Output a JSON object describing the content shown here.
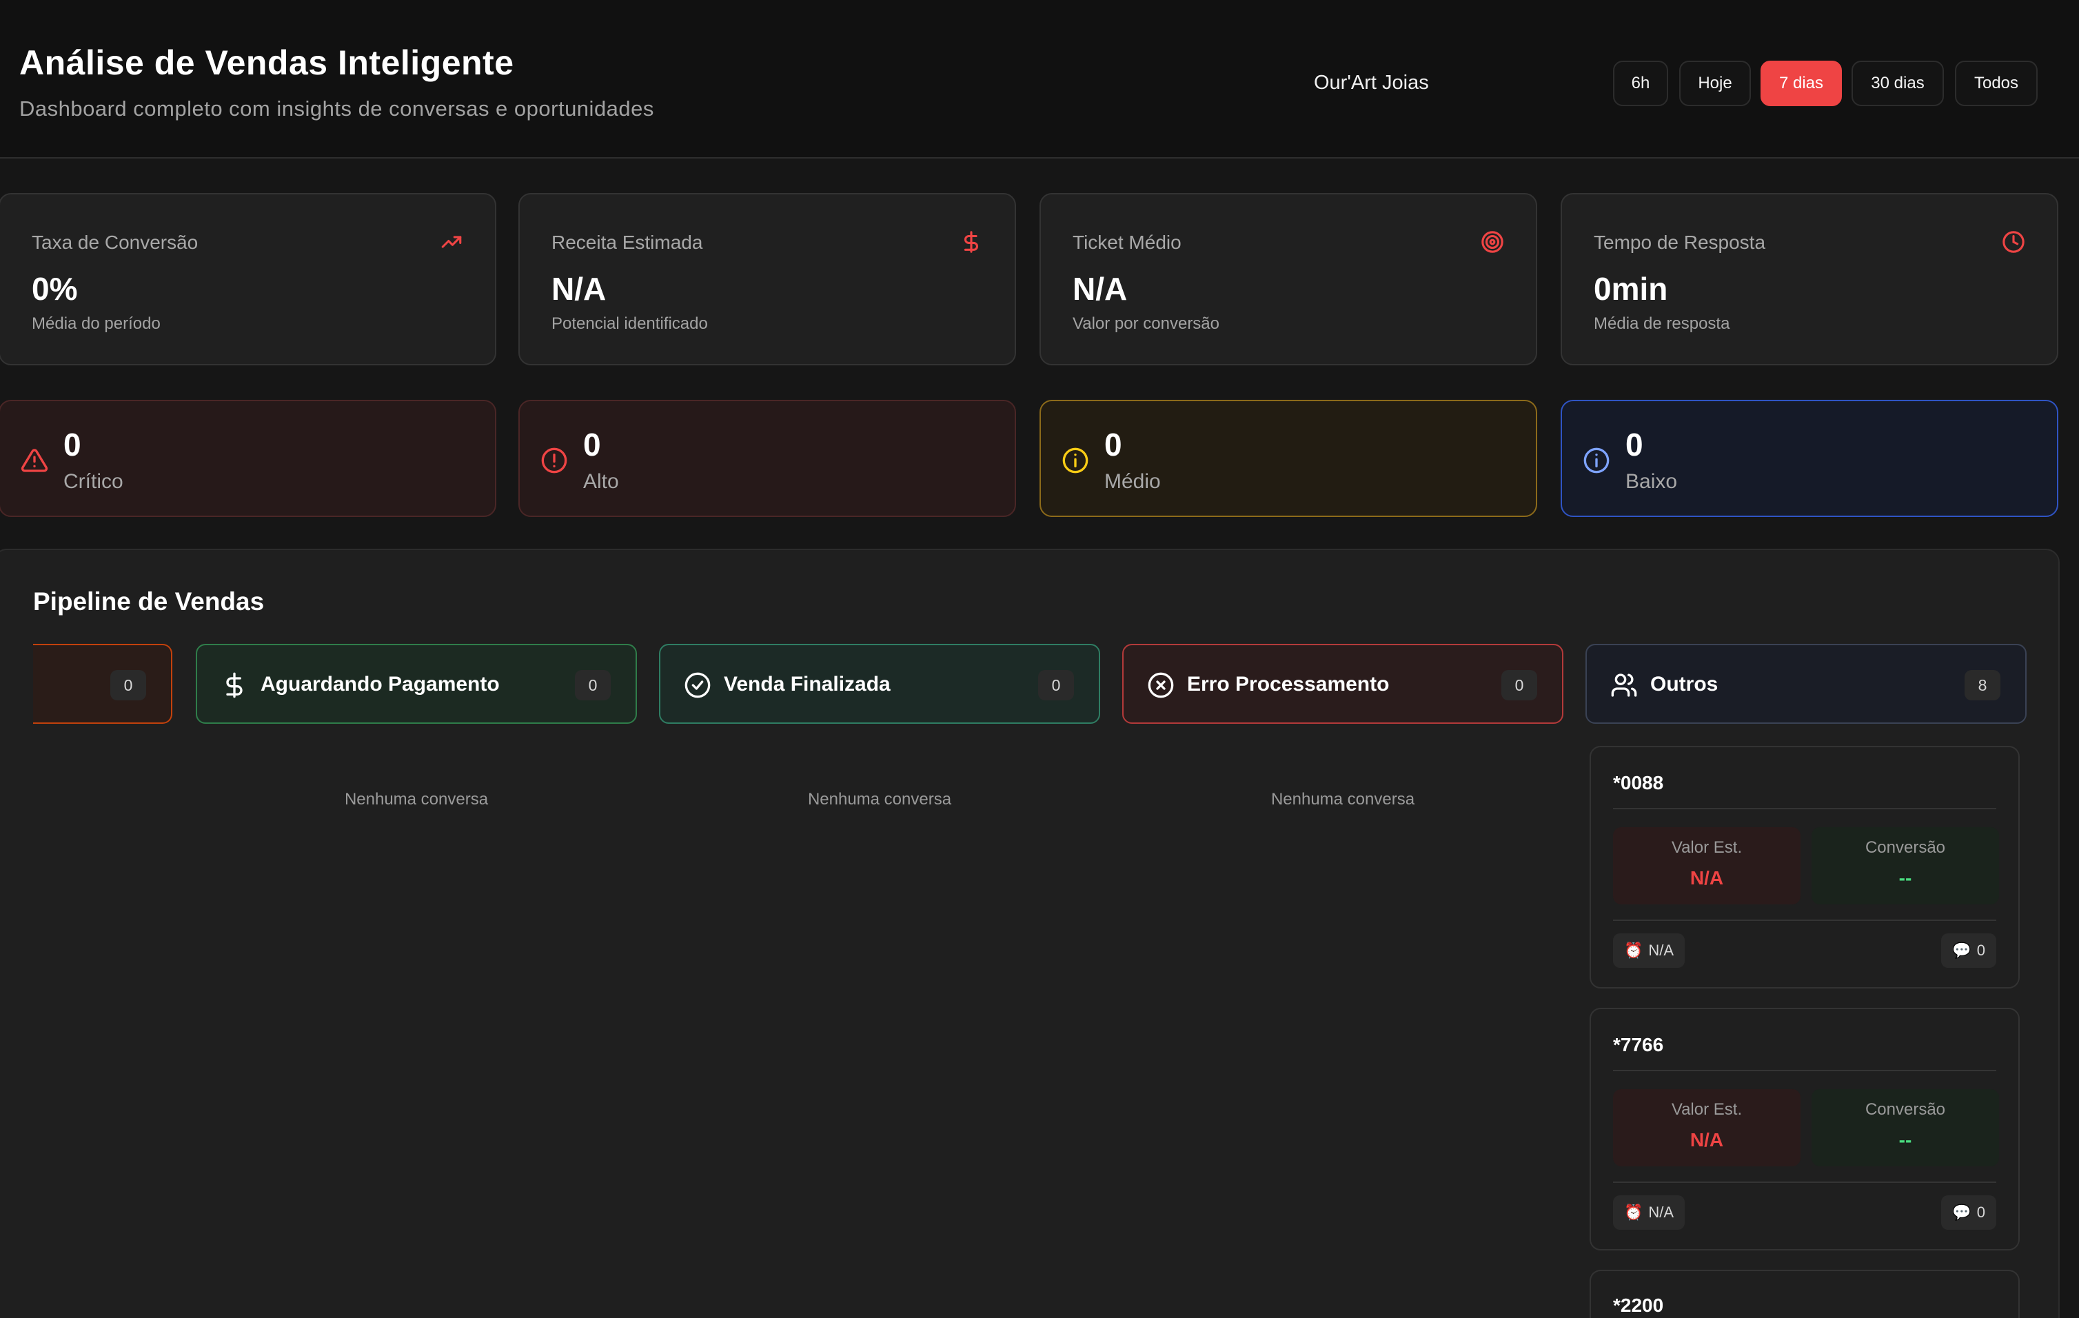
{
  "header": {
    "title": "Análise de Vendas Inteligente",
    "subtitle": "Dashboard completo com insights de conversas e oportunidades",
    "store_name": "Our'Art Joias",
    "ranges": [
      "6h",
      "Hoje",
      "7 dias",
      "30 dias",
      "Todos"
    ],
    "selected_range": "7 dias"
  },
  "metrics": [
    {
      "label": "Taxa de Conversão",
      "value": "0%",
      "caption": "Média do período",
      "icon": "trending-up-icon"
    },
    {
      "label": "Receita Estimada",
      "value": "N/A",
      "caption": "Potencial identificado",
      "icon": "dollar-icon"
    },
    {
      "label": "Ticket Médio",
      "value": "N/A",
      "caption": "Valor por conversão",
      "icon": "target-icon"
    },
    {
      "label": "Tempo de Resposta",
      "value": "0min",
      "caption": "Média de resposta",
      "icon": "clock-icon"
    }
  ],
  "priorities": [
    {
      "count": "0",
      "label": "Crítico",
      "icon": "warning-triangle-icon"
    },
    {
      "count": "0",
      "label": "Alto",
      "icon": "alert-circle-icon"
    },
    {
      "count": "0",
      "label": "Médio",
      "icon": "info-circle-icon"
    },
    {
      "count": "0",
      "label": "Baixo",
      "icon": "info-circle-icon"
    }
  ],
  "pipeline": {
    "title": "Pipeline de Vendas",
    "columns": [
      {
        "name": "",
        "count": "0"
      },
      {
        "name": "Aguardando Pagamento",
        "count": "0",
        "icon": "dollar-icon"
      },
      {
        "name": "Venda Finalizada",
        "count": "0",
        "icon": "check-circle-icon"
      },
      {
        "name": "Erro Processamento",
        "count": "0",
        "icon": "x-circle-icon"
      },
      {
        "name": "Outros",
        "count": "8",
        "icon": "users-icon"
      }
    ],
    "empty_text": "Nenhuma conversa",
    "conversations": [
      {
        "id": "*0088",
        "valor_label": "Valor Est.",
        "valor": "N/A",
        "conv_label": "Conversão",
        "conv": "--",
        "time": "N/A",
        "messages": "0"
      },
      {
        "id": "*7766",
        "valor_label": "Valor Est.",
        "valor": "N/A",
        "conv_label": "Conversão",
        "conv": "--",
        "time": "N/A",
        "messages": "0"
      },
      {
        "id": "*2200"
      }
    ]
  },
  "colors": {
    "accent": "#ef4444",
    "success": "#4ade80",
    "warning": "#facc15",
    "info": "#7ea3ff"
  }
}
